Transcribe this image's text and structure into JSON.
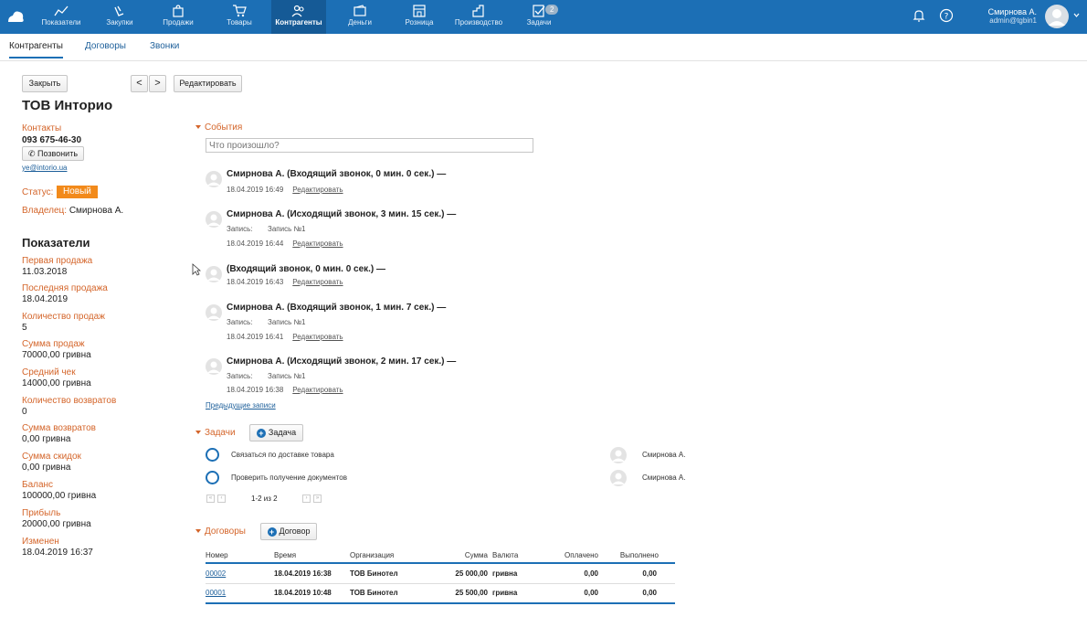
{
  "nav": {
    "items": [
      {
        "label": "Показатели",
        "icon": "chart-icon"
      },
      {
        "label": "Закупки",
        "icon": "basket-icon"
      },
      {
        "label": "Продажи",
        "icon": "bag-icon"
      },
      {
        "label": "Товары",
        "icon": "cart-icon"
      },
      {
        "label": "Контрагенты",
        "icon": "users-icon"
      },
      {
        "label": "Деньги",
        "icon": "wallet-icon"
      },
      {
        "label": "Розница",
        "icon": "store-icon"
      },
      {
        "label": "Производство",
        "icon": "factory-icon"
      },
      {
        "label": "Задачи",
        "icon": "tasks-icon",
        "badge": "2"
      }
    ],
    "active": "Контрагенты"
  },
  "user": {
    "name": "Смирнова А.",
    "login": "admin@tgbin1"
  },
  "subnav": {
    "tabs": [
      "Контрагенты",
      "Договоры",
      "Звонки"
    ]
  },
  "toolbar": {
    "close": "Закрыть",
    "prev": "<",
    "next": ">",
    "edit": "Редактировать"
  },
  "contact": {
    "name": "ТОВ Инторио",
    "contacts_label": "Контакты",
    "phone": "093 675-46-30",
    "call_button": "Позвонить",
    "email": "ye@intorio.ua",
    "status_label": "Статус:",
    "status": "Новый",
    "owner_label": "Владелец:",
    "owner": "Смирнова А."
  },
  "metrics": {
    "title": "Показатели",
    "items": [
      {
        "label": "Первая продажа",
        "value": "11.03.2018"
      },
      {
        "label": "Последняя продажа",
        "value": "18.04.2019"
      },
      {
        "label": "Количество продаж",
        "value": "5"
      },
      {
        "label": "Сумма продаж",
        "value": "70000,00 гривна"
      },
      {
        "label": "Средний чек",
        "value": "14000,00 гривна"
      },
      {
        "label": "Количество возвратов",
        "value": "0"
      },
      {
        "label": "Сумма возвратов",
        "value": "0,00 гривна"
      },
      {
        "label": "Сумма скидок",
        "value": "0,00 гривна"
      },
      {
        "label": "Баланс",
        "value": "100000,00 гривна"
      },
      {
        "label": "Прибыль",
        "value": "20000,00 гривна"
      },
      {
        "label": "Изменен",
        "value": "18.04.2019 16:37"
      }
    ]
  },
  "events": {
    "title": "События",
    "placeholder": "Что произошло?",
    "edit_label": "Редактировать",
    "record_label": "Запись:",
    "items": [
      {
        "title": "Смирнова А. (Входящий звонок, 0 мин. 0 сек.) —",
        "time": "18.04.2019 16:49"
      },
      {
        "title": "Смирнова А. (Исходящий звонок, 3 мин. 15 сек.) —",
        "record": "Запись №1",
        "time": "18.04.2019 16:44"
      },
      {
        "title": "(Входящий звонок, 0 мин. 0 сек.) —",
        "time": "18.04.2019 16:43"
      },
      {
        "title": "Смирнова А. (Входящий звонок, 1 мин. 7 сек.) —",
        "record": "Запись №1",
        "time": "18.04.2019 16:41"
      },
      {
        "title": "Смирнова А. (Исходящий звонок, 2 мин. 17 сек.) —",
        "record": "Запись №1",
        "time": "18.04.2019 16:38"
      }
    ],
    "prev_link": "Предыдущие записи"
  },
  "tasks": {
    "title": "Задачи",
    "add_button": "Задача",
    "items": [
      {
        "text": "Связаться по доставке товара",
        "user": "Смирнова А."
      },
      {
        "text": "Проверить получение документов",
        "user": "Смирнова А."
      }
    ],
    "pagination": "1-2 из 2"
  },
  "contracts": {
    "title": "Договоры",
    "add_button": "Договор",
    "columns": [
      "Номер",
      "Время",
      "Организация",
      "Сумма",
      "Валюта",
      "Оплачено",
      "Выполнено"
    ],
    "rows": [
      [
        "00002",
        "18.04.2019 16:38",
        "ТОВ Бинотел",
        "25 000,00",
        "гривна",
        "0,00",
        "0,00"
      ],
      [
        "00001",
        "18.04.2019 10:48",
        "ТОВ Бинотел",
        "25 500,00",
        "гривна",
        "0,00",
        "0,00"
      ]
    ]
  }
}
